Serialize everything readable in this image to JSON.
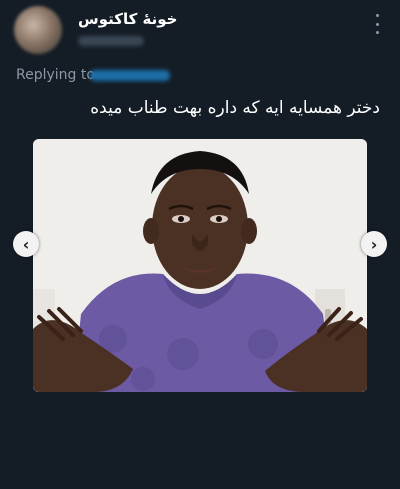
{
  "tweet": {
    "display_name": "خونهٔ کاکتوس",
    "replying_to_label": "Replying to",
    "text": "دختر همسایه ایه که داره بهت طناب میده",
    "menu_icon": "more-vertical-icon"
  },
  "media": {
    "prev_icon": "‹",
    "next_icon": "›"
  }
}
